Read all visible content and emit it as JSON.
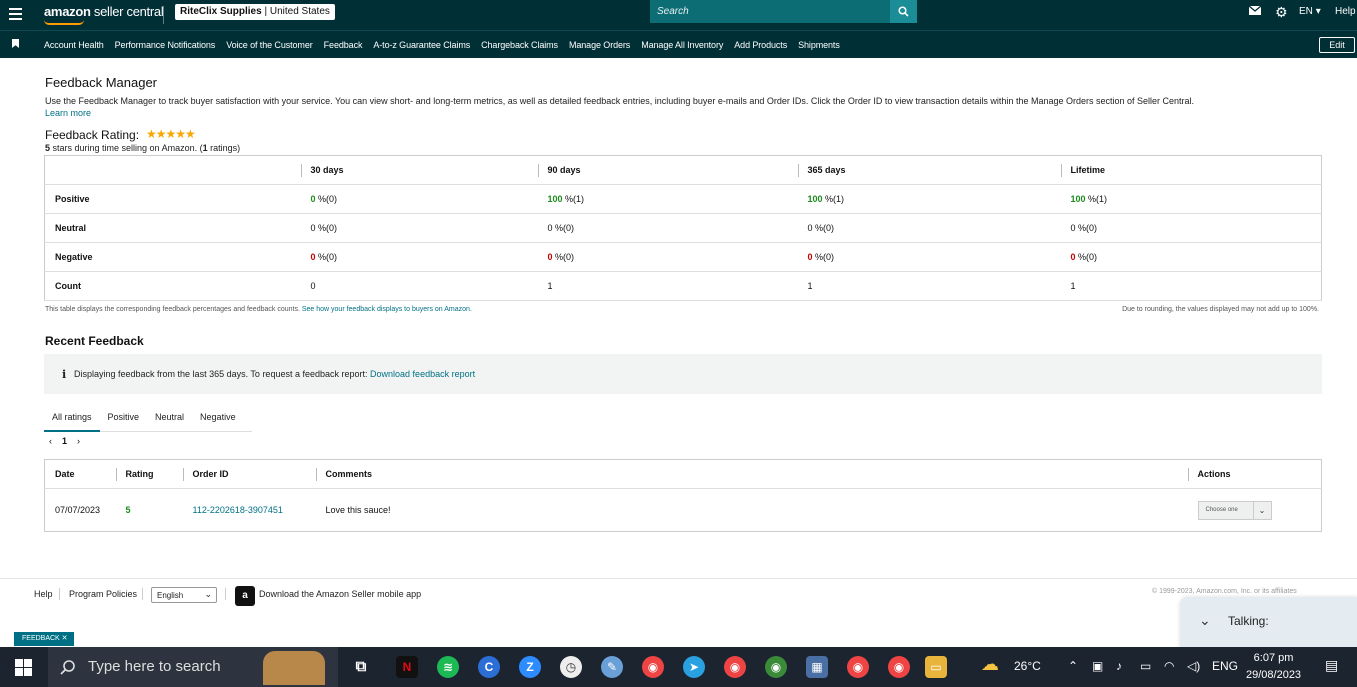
{
  "header": {
    "logo_main": "amazon",
    "logo_sub": "seller central",
    "store_name": "RiteClix Supplies",
    "store_region": "United States",
    "search_placeholder": "Search",
    "lang": "EN",
    "help": "Help"
  },
  "nav": {
    "items": [
      "Account Health",
      "Performance Notifications",
      "Voice of the Customer",
      "Feedback",
      "A-to-z Guarantee Claims",
      "Chargeback Claims",
      "Manage Orders",
      "Manage All Inventory",
      "Add Products",
      "Shipments"
    ],
    "edit": "Edit"
  },
  "page": {
    "title": "Feedback Manager",
    "intro": "Use the Feedback Manager to track buyer satisfaction with your service. You can view short- and long-term metrics, as well as detailed feedback entries, including buyer e-mails and Order IDs. Click the Order ID to view transaction details within the Manage Orders section of Seller Central.",
    "learn_more": "Learn more",
    "rating_label": "Feedback Rating:",
    "rating_stars": "★★★★★",
    "rating_value": 5,
    "rating_sub_stars": "5",
    "rating_sub_mid": " stars during time selling on Amazon. (",
    "rating_sub_count": "1",
    "rating_sub_end": " ratings)"
  },
  "stats": {
    "columns": [
      "30 days",
      "90 days",
      "365 days",
      "Lifetime"
    ],
    "rows": [
      {
        "label": "Positive",
        "cells": [
          {
            "v": "0",
            "s": " %(0)",
            "c": "green"
          },
          {
            "v": "100",
            "s": " %(1)",
            "c": "green"
          },
          {
            "v": "100",
            "s": " %(1)",
            "c": "green"
          },
          {
            "v": "100",
            "s": " %(1)",
            "c": "green"
          }
        ]
      },
      {
        "label": "Neutral",
        "cells": [
          {
            "v": "0",
            "s": " %(0)",
            "c": ""
          },
          {
            "v": "0",
            "s": " %(0)",
            "c": ""
          },
          {
            "v": "0",
            "s": " %(0)",
            "c": ""
          },
          {
            "v": "0",
            "s": " %(0)",
            "c": ""
          }
        ]
      },
      {
        "label": "Negative",
        "cells": [
          {
            "v": "0",
            "s": " %(0)",
            "c": "red"
          },
          {
            "v": "0",
            "s": " %(0)",
            "c": "red"
          },
          {
            "v": "0",
            "s": " %(0)",
            "c": "red"
          },
          {
            "v": "0",
            "s": " %(0)",
            "c": "red"
          }
        ]
      },
      {
        "label": "Count",
        "cells": [
          {
            "v": "0",
            "s": "",
            "c": ""
          },
          {
            "v": "1",
            "s": "",
            "c": ""
          },
          {
            "v": "1",
            "s": "",
            "c": ""
          },
          {
            "v": "1",
            "s": "",
            "c": ""
          }
        ]
      }
    ],
    "note_left": "This table displays the corresponding feedback percentages and feedback counts.",
    "note_left_link": "See how your feedback displays to buyers on Amazon.",
    "note_right": "Due to rounding, the values displayed may not add up to 100%."
  },
  "recent": {
    "title": "Recent Feedback",
    "info": "Displaying feedback from the last 365 days. To request a feedback report:",
    "info_link": "Download feedback report",
    "tabs": [
      "All ratings",
      "Positive",
      "Neutral",
      "Negative"
    ],
    "page": "1",
    "headers": [
      "Date",
      "Rating",
      "Order ID",
      "Comments",
      "Actions"
    ],
    "rows": [
      {
        "date": "07/07/2023",
        "rating": "5",
        "order_id": "112-2202618-3907451",
        "comment": "Love this sauce!",
        "action": "Choose one"
      }
    ]
  },
  "footer": {
    "help": "Help",
    "policies": "Program Policies",
    "language": "English",
    "app": "Download the Amazon Seller mobile app",
    "copyright": "© 1999-2023, Amazon.com, Inc. or its affiliates",
    "tag": "FEEDBACK ✕",
    "talking": "Talking:"
  },
  "taskbar": {
    "search": "Type here to search",
    "temp": "26°C",
    "lang": "ENG",
    "time": "6:07 pm",
    "date": "29/08/2023"
  },
  "colors": {
    "header_bg": "#002f36",
    "accent": "#007185",
    "positive": "#1e8c1e",
    "negative": "#c40000",
    "star": "#f7a700"
  }
}
